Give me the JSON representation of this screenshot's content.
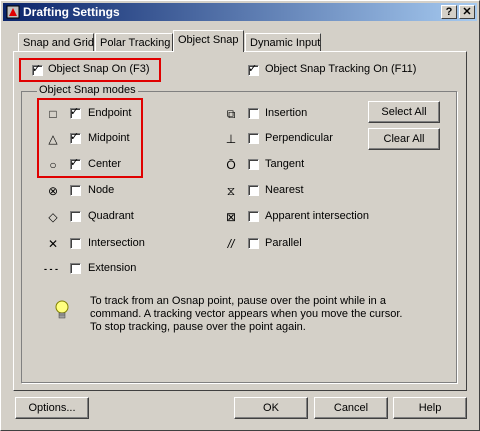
{
  "window": {
    "title": "Drafting Settings",
    "help_glyph": "?",
    "close_glyph": "✕"
  },
  "tabs": [
    {
      "label": "Snap and Grid"
    },
    {
      "label": "Polar Tracking"
    },
    {
      "label": "Object Snap"
    },
    {
      "label": "Dynamic Input"
    }
  ],
  "object_snap_on": {
    "label": "Object Snap On (F3)",
    "checked": true
  },
  "object_snap_tracking_on": {
    "label": "Object Snap Tracking On (F11)",
    "checked": true
  },
  "group_title": "Object Snap modes",
  "modes_left": [
    {
      "label": "Endpoint",
      "checked": true,
      "symbol": "□",
      "icon": "endpoint-icon"
    },
    {
      "label": "Midpoint",
      "checked": true,
      "symbol": "△",
      "icon": "midpoint-icon"
    },
    {
      "label": "Center",
      "checked": true,
      "symbol": "○",
      "icon": "center-icon"
    },
    {
      "label": "Node",
      "checked": false,
      "symbol": "⊗",
      "icon": "node-icon"
    },
    {
      "label": "Quadrant",
      "checked": false,
      "symbol": "◇",
      "icon": "quadrant-icon"
    },
    {
      "label": "Intersection",
      "checked": false,
      "symbol": "✕",
      "icon": "intersection-icon"
    },
    {
      "label": "Extension",
      "checked": false,
      "symbol": "- - -",
      "icon": "extension-icon"
    }
  ],
  "modes_right": [
    {
      "label": "Insertion",
      "checked": false,
      "symbol": "⧉",
      "icon": "insertion-icon"
    },
    {
      "label": "Perpendicular",
      "checked": false,
      "symbol": "⊥",
      "icon": "perpendicular-icon"
    },
    {
      "label": "Tangent",
      "checked": false,
      "symbol": "Ō",
      "icon": "tangent-icon"
    },
    {
      "label": "Nearest",
      "checked": false,
      "symbol": "⧖",
      "icon": "nearest-icon"
    },
    {
      "label": "Apparent intersection",
      "checked": false,
      "symbol": "⊠",
      "icon": "apparent-intersection-icon"
    },
    {
      "label": "Parallel",
      "checked": false,
      "symbol": "//",
      "icon": "parallel-icon"
    }
  ],
  "buttons": {
    "select_all": "Select All",
    "clear_all": "Clear All",
    "options": "Options...",
    "ok": "OK",
    "cancel": "Cancel",
    "help": "Help"
  },
  "tip_lines": [
    "To track from an Osnap point, pause over the point while in a",
    "command.  A tracking vector appears when you move the cursor.",
    "To stop tracking, pause over the point again."
  ],
  "check_glyph": "✓"
}
